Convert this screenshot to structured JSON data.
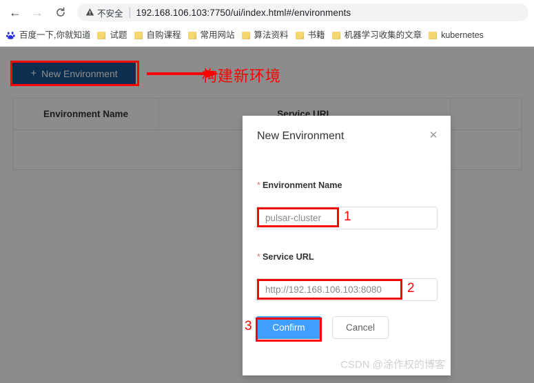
{
  "browser": {
    "back_icon": "arrow-left-icon",
    "forward_icon": "arrow-right-icon",
    "reload_icon": "reload-icon",
    "security_icon": "warning-triangle-icon",
    "security_label": "不安全",
    "url": "192.168.106.103:7750/ui/index.html#/environments",
    "bookmarks": [
      {
        "label": "百度一下,你就知道",
        "icon": "baidu-icon"
      },
      {
        "label": "试题",
        "icon": "folder-icon"
      },
      {
        "label": "自购课程",
        "icon": "folder-icon"
      },
      {
        "label": "常用网站",
        "icon": "folder-icon"
      },
      {
        "label": "算法资料",
        "icon": "folder-icon"
      },
      {
        "label": "书籍",
        "icon": "folder-icon"
      },
      {
        "label": "机器学习收集的文章",
        "icon": "folder-icon"
      },
      {
        "label": "kubernetes",
        "icon": "folder-icon"
      }
    ]
  },
  "page": {
    "new_environment_button": "New Environment",
    "new_environment_plus": "+",
    "table": {
      "headers": [
        "Environment Name",
        "Service URL",
        ""
      ]
    }
  },
  "modal": {
    "title": "New Environment",
    "close_icon": "close-icon",
    "fields": {
      "env_name": {
        "required_marker": "*",
        "label": "Environment Name",
        "value": "pulsar-cluster"
      },
      "service_url": {
        "required_marker": "*",
        "label": "Service URL",
        "value": "http://192.168.106.103:8080"
      }
    },
    "confirm_label": "Confirm",
    "cancel_label": "Cancel"
  },
  "annotations": {
    "arrow_label": "构建新环境",
    "step_1": "1",
    "step_2": "2",
    "step_3": "3",
    "color": "#ff0000"
  },
  "watermark": "CSDN @涂作权的博客",
  "colors": {
    "primary_button": "#409eff",
    "new_env_button": "#1a5490",
    "required_star": "#f56c6c",
    "annotation_red": "#ff0000"
  }
}
